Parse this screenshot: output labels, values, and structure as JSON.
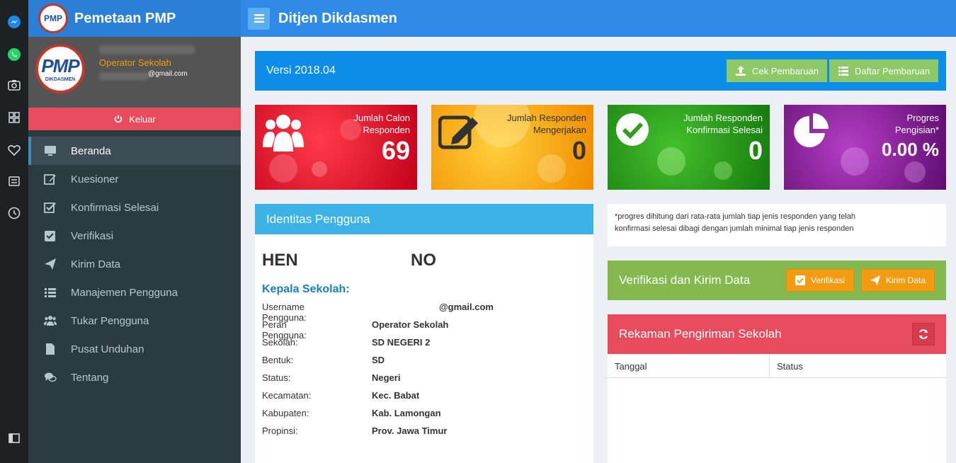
{
  "dock": {
    "icons": [
      "messenger-icon",
      "whatsapp-icon",
      "camera-icon",
      "grid-icon",
      "heart-icon",
      "news-icon",
      "clock-icon",
      "panel-toggle-icon"
    ]
  },
  "sidebar": {
    "brand_title": "Pemetaan PMP",
    "brand_logo_text": "PMP",
    "user": {
      "avatar_text": "PMP",
      "avatar_sub": "DIKDASMEN",
      "role": "Operator Sekolah",
      "email": "@gmail.com"
    },
    "logout_label": "Keluar",
    "items": [
      {
        "label": "Beranda",
        "active": true
      },
      {
        "label": "Kuesioner"
      },
      {
        "label": "Konfirmasi Selesai"
      },
      {
        "label": "Verifikasi"
      },
      {
        "label": "Kirim Data"
      },
      {
        "label": "Manajemen Pengguna"
      },
      {
        "label": "Tukar Pengguna"
      },
      {
        "label": "Pusat Unduhan"
      },
      {
        "label": "Tentang"
      }
    ]
  },
  "header": {
    "title": "Ditjen Dikdasmen"
  },
  "version": {
    "text": "Versi 2018.04",
    "check_update_label": "Cek Pembaruan",
    "update_list_label": "Daftar Pembaruan"
  },
  "stats": [
    {
      "label_line1": "Jumlah Calon",
      "label_line2": "Responden",
      "value": "69",
      "color": "#e0162b"
    },
    {
      "label_line1": "Jumlah Responden",
      "label_line2": "Mengerjakan",
      "value": "0",
      "color": "#f39c12"
    },
    {
      "label_line1": "Jumlah Responden",
      "label_line2": "Konfirmasi Selesai",
      "value": "0",
      "color": "#2e9e1e"
    },
    {
      "label_line1": "Progres",
      "label_line2": "Pengisian*",
      "value": "0.00 %",
      "color": "#8e1a9c"
    }
  ],
  "identity": {
    "panel_title": "Identitas Pengguna",
    "name_part1": "HEN",
    "name_part2": "NO",
    "subtitle": "Kepala Sekolah:",
    "rows": [
      {
        "key": "Username Pengguna:",
        "value": "@gmail.com"
      },
      {
        "key": "Peran Pengguna:",
        "value": "Operator Sekolah"
      },
      {
        "key": "Sekolah:",
        "value": "SD NEGERI 2"
      },
      {
        "key": "Bentuk:",
        "value": "SD"
      },
      {
        "key": "Status:",
        "value": "Negeri"
      },
      {
        "key": "Kecamatan:",
        "value": "Kec. Babat"
      },
      {
        "key": "Kabupaten:",
        "value": "Kab. Lamongan"
      },
      {
        "key": "Propinsi:",
        "value": "Prov. Jawa Timur"
      }
    ]
  },
  "note": {
    "line1": "*progres dihitung dari rata-rata jumlah tiap jenis responden yang telah",
    "line2": "konfirmasi selesai dibagi dengan jumlah minimal tiap jenis responden"
  },
  "verify": {
    "title": "Verifikasi dan Kirim Data",
    "verify_label": "Verifikasi",
    "send_label": "Kirim Data"
  },
  "records": {
    "title": "Rekaman Pengiriman Sekolah",
    "columns": [
      "Tanggal",
      "Status"
    ]
  }
}
